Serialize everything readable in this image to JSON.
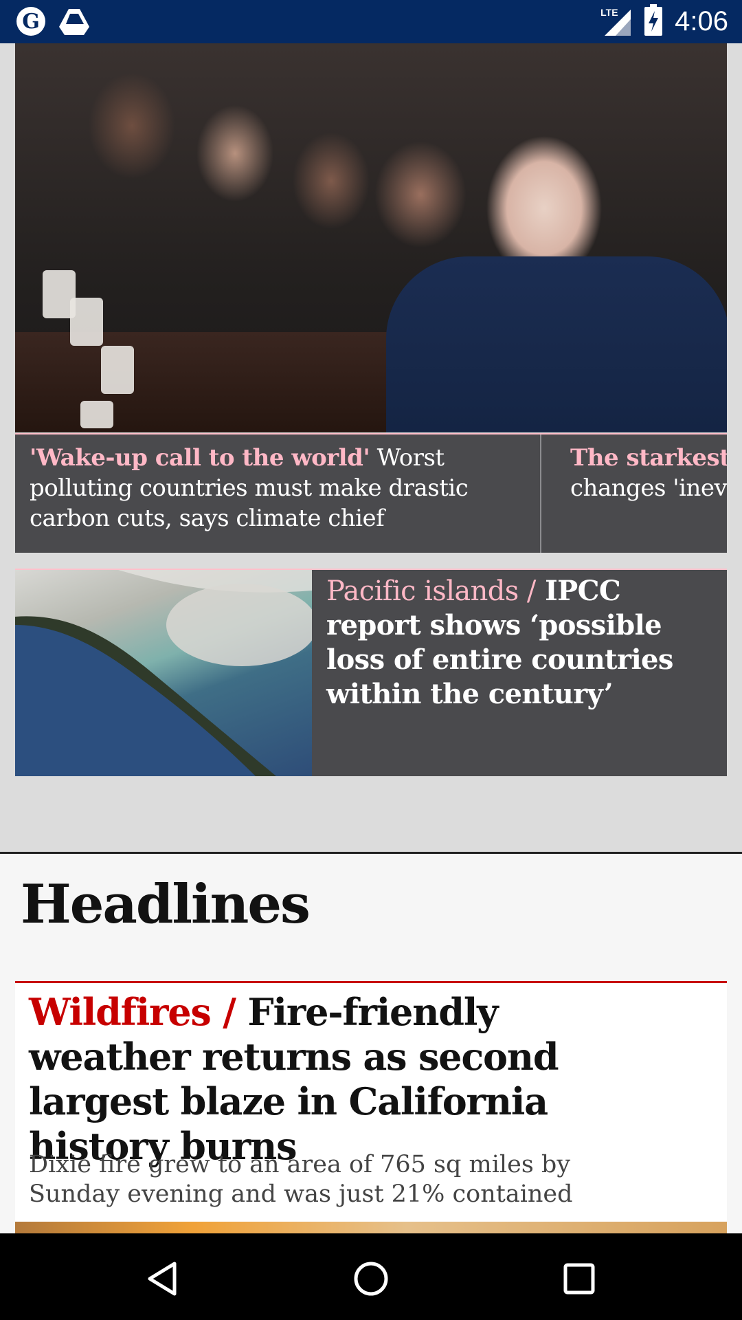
{
  "status_bar": {
    "time": "4:06",
    "network_label": "LTE",
    "icons": [
      "guardian-app-icon",
      "drive-icon",
      "signal-icon",
      "battery-charging-icon"
    ]
  },
  "featured": {
    "hero_image_alt": "Joe Biden at a cabinet meeting",
    "cards": [
      {
        "kicker": "'Wake-up call to the world'",
        "headline": "Worst polluting countries must make drastic carbon cuts, says climate chief"
      },
      {
        "kicker": "The starkest w",
        "headline": "changes 'inevita"
      }
    ],
    "pacific": {
      "kicker": "Pacific islands /",
      "headline": "IPCC report shows ‘possible loss of entire countries within the century’"
    }
  },
  "headlines": {
    "section_title": "Headlines",
    "top_story": {
      "kicker": "Wildfires /",
      "headline": "Fire-friendly weather returns as second largest blaze in California history burns",
      "standfirst": "Dixie fire grew to an area of 765 sq miles by Sunday evening and was just 21% contained"
    }
  },
  "nav": {
    "back": "back-icon",
    "home": "home-icon",
    "recents": "recents-icon"
  },
  "colors": {
    "status_bar": "#052962",
    "card_bg": "#4a4a4d",
    "kicker_pink": "#ffb8c6",
    "kicker_red": "#c70000"
  }
}
